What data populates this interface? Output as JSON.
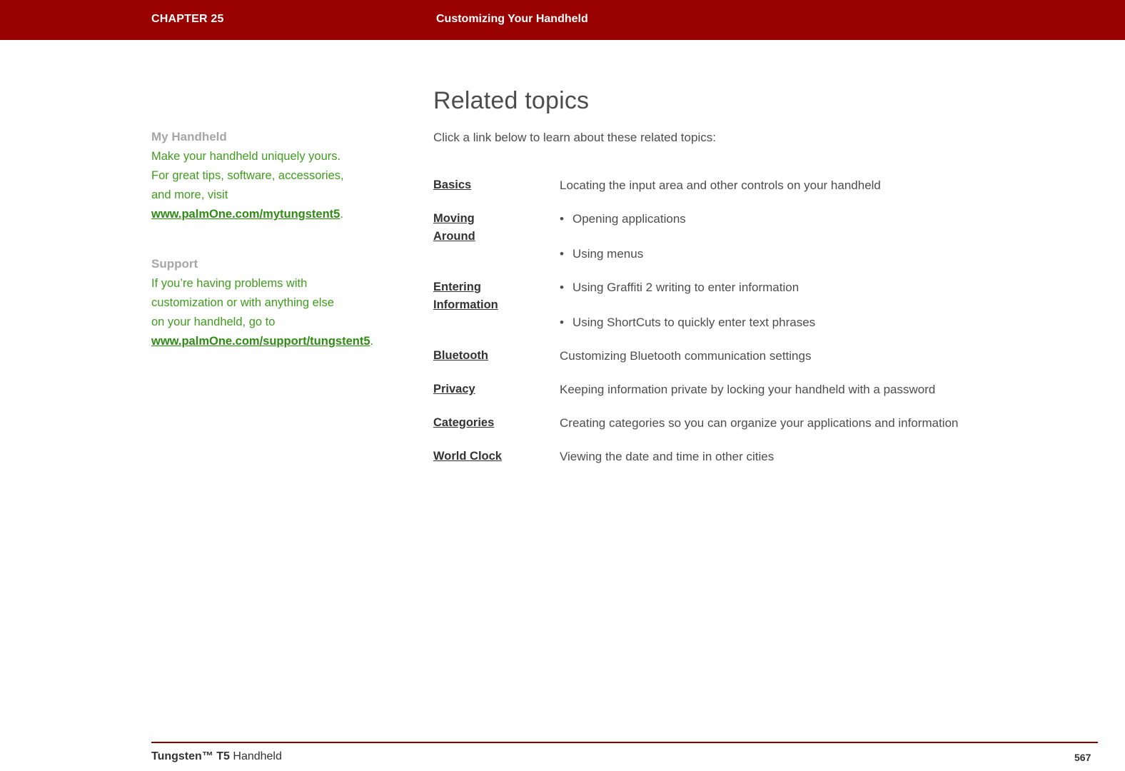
{
  "header": {
    "chapter": "CHAPTER 25",
    "title": "Customizing Your Handheld"
  },
  "sidebar": {
    "blocks": [
      {
        "heading": "My Handheld",
        "text_before": "Make your handheld uniquely yours. For great tips, software, accessories, and more, visit ",
        "link": "www.palmOne.com/mytungstent5",
        "text_after": "."
      },
      {
        "heading": "Support",
        "text_before": "If you’re having problems with customization or with anything else on your handheld, go to ",
        "link": "www.palmOne.com/support/tungstent5",
        "text_after": "."
      }
    ]
  },
  "main": {
    "title": "Related topics",
    "intro": "Click a link below to learn about these related topics:",
    "topics": [
      {
        "link": "Basics",
        "link_line2": "",
        "items": [
          "Locating the input area and other controls on your handheld"
        ],
        "bulleted": false
      },
      {
        "link": "Moving ",
        "link_line2": "Around",
        "items": [
          "Opening applications",
          "Using menus"
        ],
        "bulleted": true
      },
      {
        "link": "Entering ",
        "link_line2": "Information",
        "items": [
          "Using Graffiti 2 writing to enter information",
          "Using ShortCuts to quickly enter text phrases"
        ],
        "bulleted": true
      },
      {
        "link": "Bluetooth",
        "link_line2": "",
        "items": [
          "Customizing Bluetooth communication settings"
        ],
        "bulleted": false
      },
      {
        "link": "Privacy",
        "link_line2": "",
        "items": [
          "Keeping information private by locking your handheld with a password"
        ],
        "bulleted": false
      },
      {
        "link": "Categories",
        "link_line2": "",
        "items": [
          "Creating categories so you can organize your applications and information"
        ],
        "bulleted": false
      },
      {
        "link": "World Clock",
        "link_line2": "",
        "items": [
          "Viewing the date and time in other cities"
        ],
        "bulleted": false
      }
    ]
  },
  "footer": {
    "product_bold": "Tungsten",
    "product_tm": "™",
    "product_model": " T5",
    "product_suffix": " Handheld",
    "page": "567"
  },
  "colors": {
    "header_bg": "#990000",
    "link_green": "#2e8b13",
    "body_gray": "#4d4d4d",
    "heading_gray": "#a6a6a6"
  }
}
